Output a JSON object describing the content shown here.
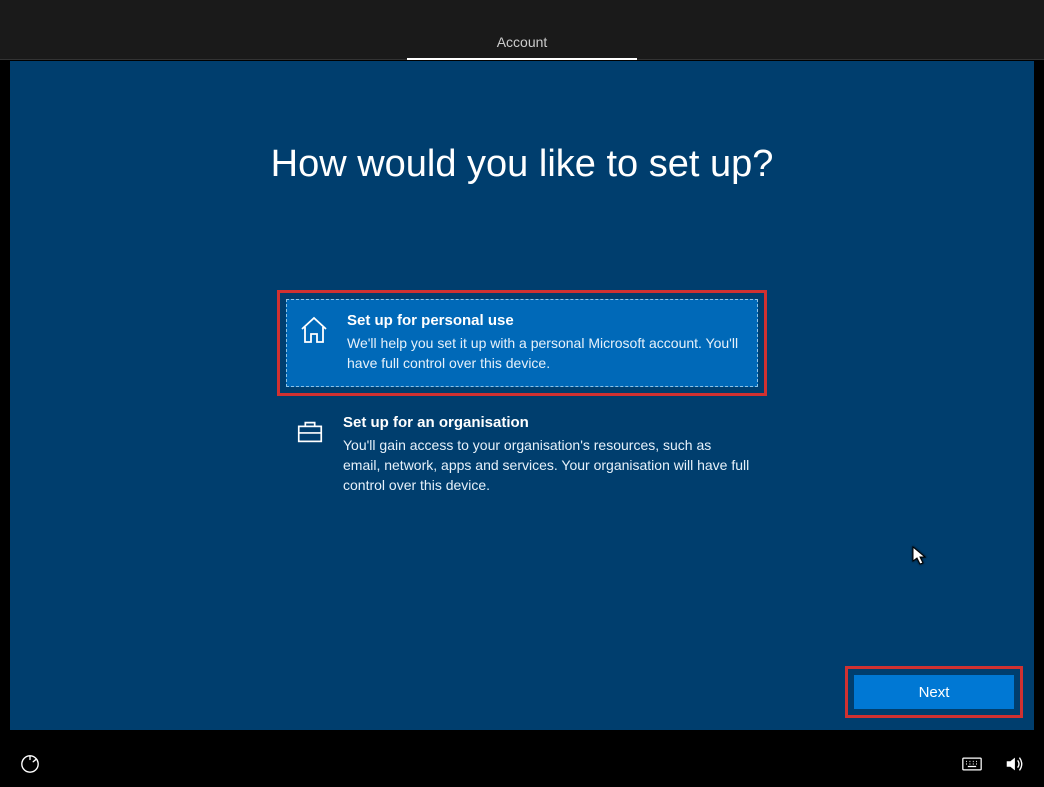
{
  "header": {
    "tab_label": "Account"
  },
  "title": "How would you like to set up?",
  "options": [
    {
      "title": "Set up for personal use",
      "description": "We'll help you set it up with a personal Microsoft account. You'll have full control over this device.",
      "selected": true,
      "highlighted": true,
      "icon": "home"
    },
    {
      "title": "Set up for an organisation",
      "description": "You'll gain access to your organisation's resources, such as email, network, apps and services. Your organisation will have full control over this device.",
      "selected": false,
      "highlighted": false,
      "icon": "briefcase"
    }
  ],
  "buttons": {
    "next": "Next"
  }
}
